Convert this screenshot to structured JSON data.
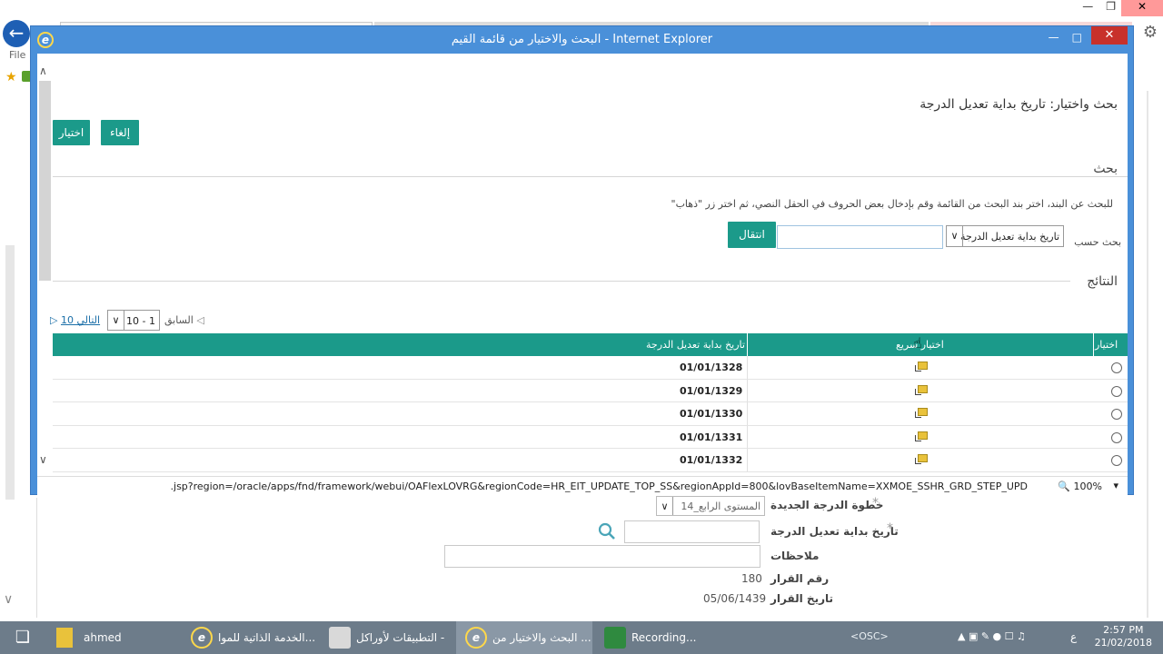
{
  "background": {
    "menu_file": "File",
    "form": {
      "new_grade_step_label": "خطوة الدرجة الجديدة",
      "new_grade_step_value": "المستوى الرابع_14",
      "grade_mod_start_label": "تاريخ بداية تعديل الدرجة",
      "notes_label": "ملاحظات",
      "decision_number_label": "رقم القرار",
      "decision_number_value": "180",
      "decision_date_label": "تاريخ القرار",
      "decision_date_value": "05/06/1439"
    }
  },
  "popup": {
    "window_title": "البحث والاختيار من قائمة القيم - Internet Explorer",
    "page_title": "بحث واختيار: تاريخ بداية تعديل الدرجة",
    "cancel_label": "إلغاء",
    "select_label": "اختيار",
    "search_section_title": "بحث",
    "instructions": "للبحث عن البند، اختر بند البحث من القائمة وقم بإدخال بعض الحروف في الحقل النصي، ثم اختر زر \"ذهاب\"",
    "search_by_label": "بحث حسب",
    "search_by_value": "تاريخ بداية تعديل الدرجة",
    "search_value": "",
    "go_label": "انتقال",
    "results_section_title": "النتائج",
    "pager": {
      "previous_label": "السابق",
      "range_value": "1 - 10",
      "next_label": "10 التالي"
    },
    "table": {
      "headers": {
        "select": "اختيار",
        "quick_select": "اختيار سريع",
        "grade_start_date": "تاريخ بداية تعديل الدرجة"
      },
      "rows": [
        {
          "date": "01/01/1328"
        },
        {
          "date": "01/01/1329"
        },
        {
          "date": "01/01/1330"
        },
        {
          "date": "01/01/1331"
        },
        {
          "date": "01/01/1332"
        }
      ]
    },
    "status_url": ".jsp?region=/oracle/apps/fnd/framework/webui/OAFlexLOVRG&regionCode=HR_EIT_UPDATE_TOP_SS&regionAppId=800&lovBaseItemName=XXMOE_SSHR_GRD_STEP_UPD",
    "zoom": "100%"
  },
  "taskbar": {
    "items": [
      {
        "label": "ahmed"
      },
      {
        "label": "الخدمة الذاتية للموا..."
      },
      {
        "label": "التطبيقات لأوراكل - ..."
      },
      {
        "label": "البحث والاختيار من ..."
      },
      {
        "label": "Recording..."
      }
    ],
    "osc": "<OSC>",
    "lang": "ع",
    "time": "2:57 PM",
    "date": "21/02/2018"
  },
  "colors": {
    "accent": "#1b9a8a",
    "titlebar": "#4a90d9",
    "close": "#c8312b",
    "taskbar": "#6d7c8a"
  }
}
